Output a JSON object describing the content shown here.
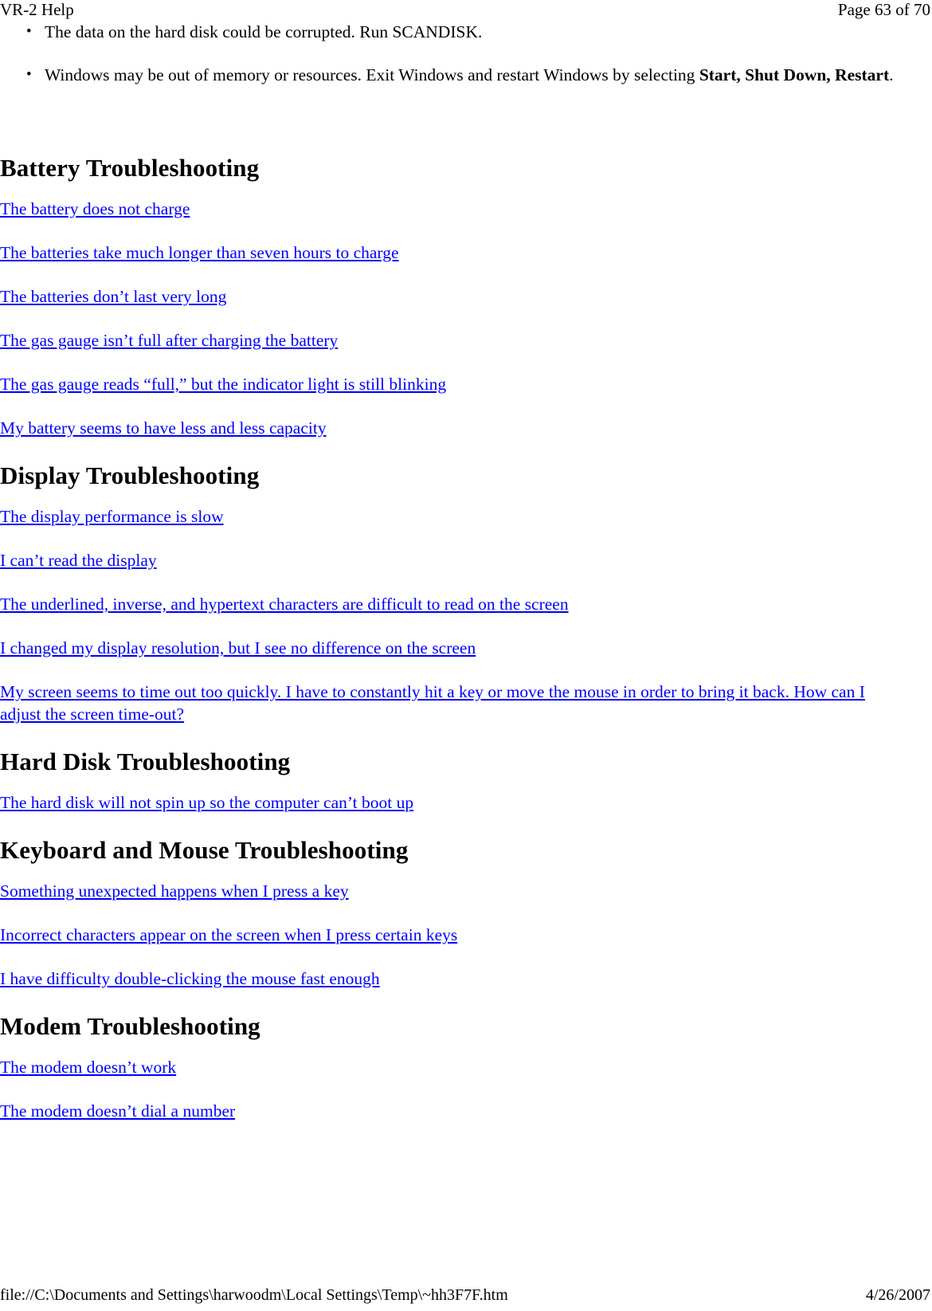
{
  "document": {
    "title": "VR-2 Help",
    "link_color": "#0000ff",
    "text_color": "#000000",
    "background_color": "#ffffff"
  },
  "header": {
    "left": "VR-2 Help",
    "right": "Page 63 of 70"
  },
  "bullets": [
    {
      "glyph": "•",
      "text": "The data on the hard disk could be corrupted.  Run SCANDISK."
    },
    {
      "glyph": "•",
      "text_before": "Windows may be out of memory or resources. Exit Windows and restart Windows by selecting ",
      "text_bold": "Start, Shut Down, Restart",
      "text_after": "."
    }
  ],
  "sections": [
    {
      "heading": "Battery Troubleshooting",
      "links": [
        "The battery does not charge",
        "The batteries take much longer than seven hours to charge",
        "The batteries don’t last very long",
        "The gas gauge isn’t full after charging the battery",
        "The gas gauge reads “full,” but the indicator light is still blinking",
        "My battery seems to have less and less capacity"
      ]
    },
    {
      "heading": "Display Troubleshooting",
      "links": [
        "The display performance is slow",
        "I can’t read the display",
        "The underlined, inverse, and hypertext characters are difficult to read on the screen",
        "I changed my display resolution, but I see no difference on the screen",
        "My screen seems to time out too quickly. I have to constantly hit a key or move the mouse in order to bring it back. How can I adjust the screen time-out?"
      ]
    },
    {
      "heading": "Hard Disk Troubleshooting",
      "links": [
        "The hard disk will not spin up so the computer can’t boot up"
      ]
    },
    {
      "heading": "Keyboard and Mouse Troubleshooting",
      "links": [
        "Something unexpected happens when I press a key",
        "Incorrect characters appear on the screen when I press certain keys",
        "I have difficulty double-clicking the mouse fast enough"
      ]
    },
    {
      "heading": "Modem Troubleshooting",
      "links": [
        "The modem doesn’t work",
        "The modem doesn’t dial a number"
      ]
    }
  ],
  "footer": {
    "left": "file://C:\\Documents and Settings\\harwoodm\\Local Settings\\Temp\\~hh3F7F.htm",
    "right": "4/26/2007"
  }
}
